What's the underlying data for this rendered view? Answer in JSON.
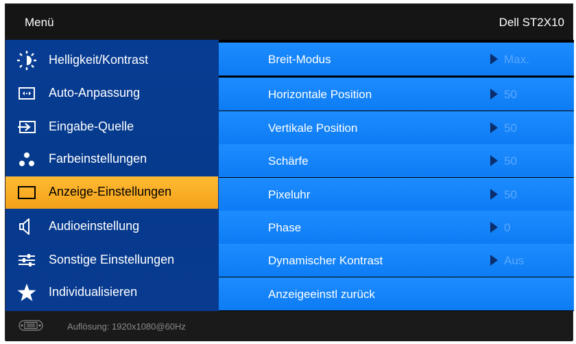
{
  "header": {
    "menu_label": "Menü",
    "model": "Dell ST2X10"
  },
  "sidebar": {
    "items": [
      {
        "label": "Helligkeit/Kontrast",
        "icon": "brightness-icon"
      },
      {
        "label": "Auto-Anpassung",
        "icon": "auto-adjust-icon"
      },
      {
        "label": "Eingabe-Quelle",
        "icon": "input-source-icon"
      },
      {
        "label": "Farbeinstellungen",
        "icon": "color-settings-icon"
      },
      {
        "label": "Anzeige-Einstellungen",
        "icon": "display-settings-icon",
        "selected": true
      },
      {
        "label": "Audioeinstellung",
        "icon": "speaker-icon"
      },
      {
        "label": "Sonstige Einstellungen",
        "icon": "other-settings-icon"
      },
      {
        "label": "Individualisieren",
        "icon": "star-icon"
      }
    ]
  },
  "settings": {
    "rows": [
      {
        "label": "Breit-Modus",
        "value": "Max."
      },
      {
        "label": "Horizontale Position",
        "value": "50"
      },
      {
        "label": "Vertikale Position",
        "value": "50"
      },
      {
        "label": "Schärfe",
        "value": "50"
      },
      {
        "label": "Pixeluhr",
        "value": "50"
      },
      {
        "label": "Phase",
        "value": "0"
      },
      {
        "label": "Dynamischer Kontrast",
        "value": "Aus"
      },
      {
        "label": "Anzeigeeinstl zurück"
      }
    ]
  },
  "status": {
    "resolution": "Auflösung:  1920x1080@60Hz",
    "icon": "vga-connector-icon"
  },
  "colors": {
    "sidebar": "#073c93",
    "selected": "#f7a823",
    "row": "#1584fb",
    "value": "#5aa8ff"
  }
}
